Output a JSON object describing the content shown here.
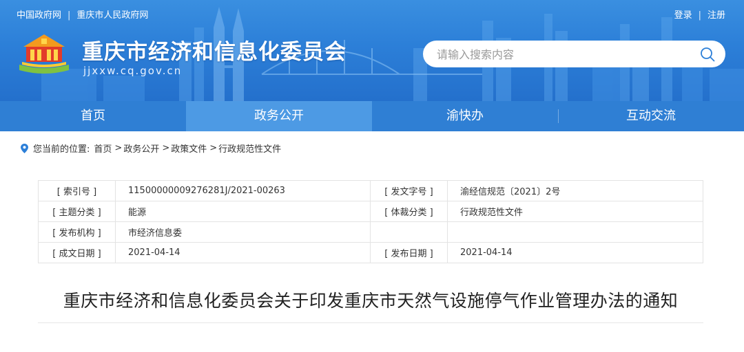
{
  "top_links": {
    "left": [
      "中国政府网",
      "重庆市人民政府网"
    ],
    "right": [
      "登录",
      "注册"
    ],
    "separator": "|"
  },
  "site": {
    "title": "重庆市经济和信息化委员会",
    "domain": "jjxxw.cq.gov.cn"
  },
  "search": {
    "placeholder": "请输入搜索内容",
    "icon": "search-icon"
  },
  "nav": {
    "items": [
      {
        "label": "首页",
        "active": false
      },
      {
        "label": "政务公开",
        "active": true
      },
      {
        "label": "渝快办",
        "active": false
      },
      {
        "label": "互动交流",
        "active": false
      }
    ]
  },
  "breadcrumb": {
    "prefix": "您当前的位置:",
    "items": [
      "首页",
      "政务公开",
      "政策文件",
      "行政规范性文件"
    ],
    "separator": ">",
    "icon": "location-pin-icon"
  },
  "meta": {
    "rows": [
      [
        {
          "label": "[ 索引号 ]",
          "value": "11500000009276281J/2021-00263"
        },
        {
          "label": "[ 发文字号 ]",
          "value": "渝经信规范〔2021〕2号"
        }
      ],
      [
        {
          "label": "[ 主题分类 ]",
          "value": "能源"
        },
        {
          "label": "[ 体裁分类 ]",
          "value": "行政规范性文件"
        }
      ],
      [
        {
          "label": "[ 发布机构 ]",
          "value": "市经济信息委"
        },
        {
          "label": "",
          "value": ""
        }
      ],
      [
        {
          "label": "[ 成文日期 ]",
          "value": "2021-04-14"
        },
        {
          "label": "[ 发布日期 ]",
          "value": "2021-04-14"
        }
      ]
    ]
  },
  "document": {
    "title": "重庆市经济和信息化委员会关于印发重庆市天然气设施停气作业管理办法的通知"
  },
  "colors": {
    "banner": "#2c7fd8",
    "nav": "#2f7fd4",
    "nav_active": "#4d9ae4"
  }
}
